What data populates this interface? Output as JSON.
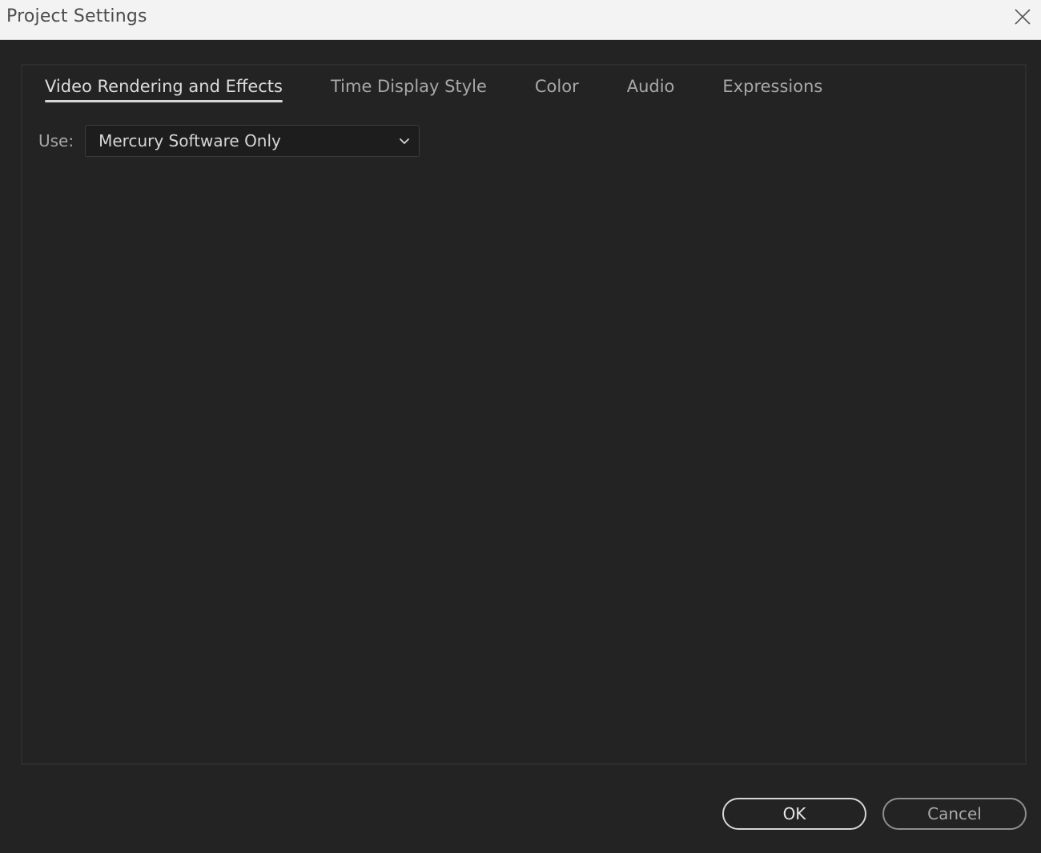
{
  "window": {
    "title": "Project Settings"
  },
  "tabs": [
    {
      "label": "Video Rendering and Effects",
      "active": true
    },
    {
      "label": "Time Display Style",
      "active": false
    },
    {
      "label": "Color",
      "active": false
    },
    {
      "label": "Audio",
      "active": false
    },
    {
      "label": "Expressions",
      "active": false
    }
  ],
  "renderer": {
    "label": "Use:",
    "selected": "Mercury Software Only"
  },
  "buttons": {
    "ok": "OK",
    "cancel": "Cancel"
  },
  "icons": {
    "close": "close-icon",
    "dropdown": "chevron-down-icon"
  },
  "colors": {
    "titlebar": "#f3f3f3",
    "background": "#232323",
    "active_tab_underline": "#d6d6d6"
  }
}
